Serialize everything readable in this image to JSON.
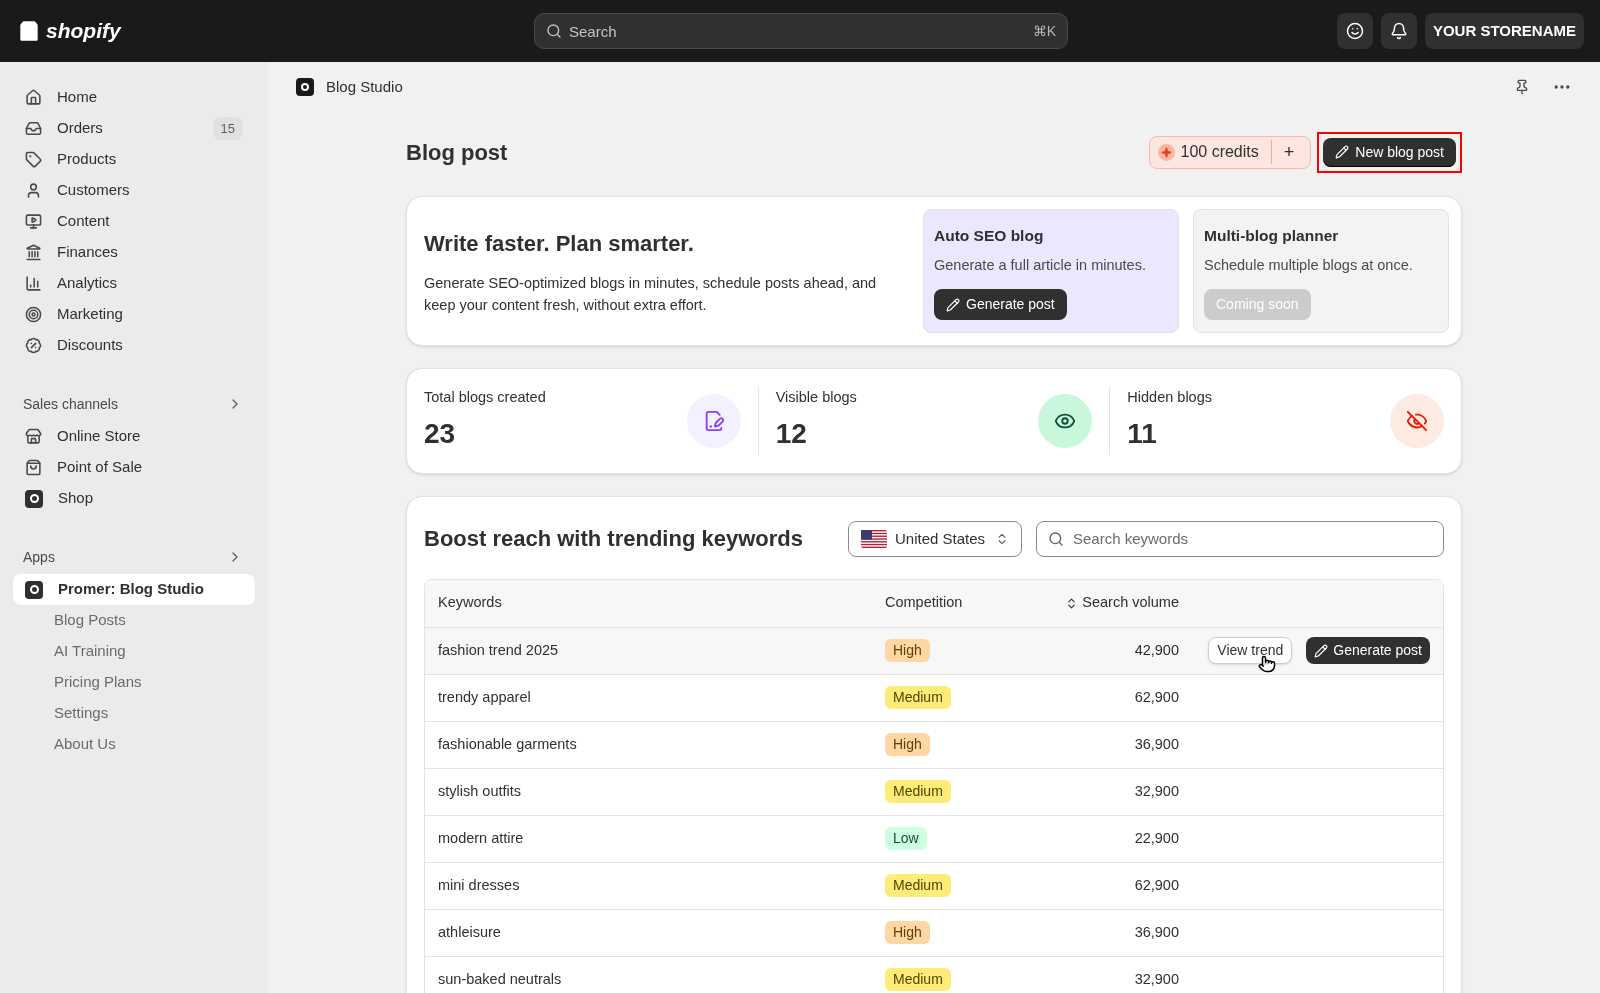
{
  "topbar": {
    "logo": "shopify",
    "search": {
      "placeholder": "Search",
      "shortcut": "⌘K"
    },
    "store": "YOUR STORENAME"
  },
  "sidebar": {
    "main": [
      {
        "label": "Home"
      },
      {
        "label": "Orders",
        "badge": "15"
      },
      {
        "label": "Products"
      },
      {
        "label": "Customers"
      },
      {
        "label": "Content"
      },
      {
        "label": "Finances"
      },
      {
        "label": "Analytics"
      },
      {
        "label": "Marketing"
      },
      {
        "label": "Discounts"
      }
    ],
    "sections": [
      {
        "title": "Sales channels",
        "items": [
          {
            "label": "Online Store",
            "selected": false
          },
          {
            "label": "Point of Sale",
            "selected": false
          },
          {
            "label": "Shop",
            "selected": false
          }
        ]
      },
      {
        "title": "Apps",
        "items": [
          {
            "label": "Promer: Blog Studio",
            "selected": true,
            "children": [
              {
                "label": "Blog Posts"
              },
              {
                "label": "AI Training"
              },
              {
                "label": "Pricing Plans"
              },
              {
                "label": "Settings"
              },
              {
                "label": "About Us"
              }
            ]
          }
        ]
      }
    ]
  },
  "breadcrumb": "Blog Studio",
  "page": {
    "title": "Blog post",
    "credits": "100 credits",
    "add": "+",
    "new_post": {
      "label": "New blog post",
      "highlighted": true
    }
  },
  "hero": {
    "title": "Write faster. Plan smarter.",
    "text": "Generate SEO-optimized blogs in minutes, schedule posts ahead, and keep your content fresh, without extra effort.",
    "cards": [
      {
        "title": "Auto SEO blog",
        "text": "Generate a full article in minutes.",
        "button": "Generate post",
        "disabled": false
      },
      {
        "title": "Multi-blog planner",
        "text": "Schedule multiple blogs at once.",
        "button": "Coming soon",
        "disabled": true
      }
    ]
  },
  "stats": [
    {
      "label": "Total blogs created",
      "value": "23",
      "kind": "total"
    },
    {
      "label": "Visible blogs",
      "value": "12",
      "kind": "visible"
    },
    {
      "label": "Hidden blogs",
      "value": "11",
      "kind": "hidden"
    }
  ],
  "keywords": {
    "title": "Boost reach with trending keywords",
    "country": "United States",
    "search_placeholder": "Search keywords",
    "columns": [
      "Keywords",
      "Competition",
      "Search volume"
    ],
    "row_actions": {
      "view": "View trend",
      "generate": "Generate post"
    },
    "rows": [
      {
        "keyword": "fashion trend 2025",
        "competition": "High",
        "kind": "high",
        "volume": "42,900",
        "hovered": true
      },
      {
        "keyword": "trendy apparel",
        "competition": "Medium",
        "kind": "medium",
        "volume": "62,900",
        "hovered": false
      },
      {
        "keyword": "fashionable garments",
        "competition": "High",
        "kind": "high",
        "volume": "36,900",
        "hovered": false
      },
      {
        "keyword": "stylish outfits",
        "competition": "Medium",
        "kind": "medium",
        "volume": "32,900",
        "hovered": false
      },
      {
        "keyword": "modern attire",
        "competition": "Low",
        "kind": "low",
        "volume": "22,900",
        "hovered": false
      },
      {
        "keyword": "mini dresses",
        "competition": "Medium",
        "kind": "medium",
        "volume": "62,900",
        "hovered": false
      },
      {
        "keyword": "athleisure",
        "competition": "High",
        "kind": "high",
        "volume": "36,900",
        "hovered": false
      },
      {
        "keyword": "sun-baked neutrals",
        "competition": "Medium",
        "kind": "medium",
        "volume": "32,900",
        "hovered": false
      }
    ]
  }
}
